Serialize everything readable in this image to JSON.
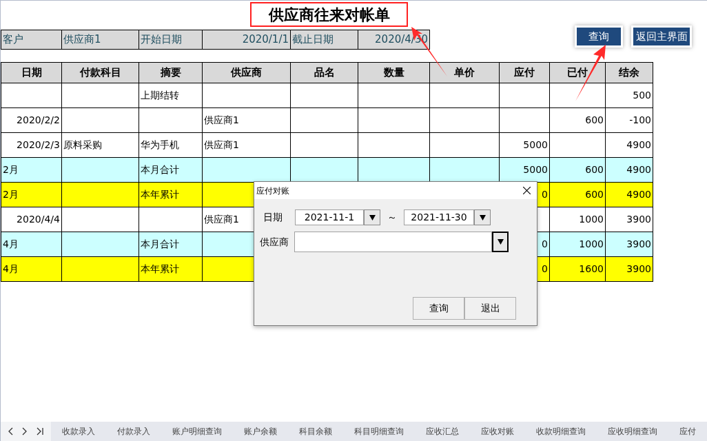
{
  "title": "供应商往来对帐单",
  "info": [
    {
      "text": "客户",
      "kind": "label"
    },
    {
      "text": "供应商1",
      "kind": "label"
    },
    {
      "text": "开始日期",
      "kind": "label"
    },
    {
      "text": "2020/1/1",
      "kind": "value"
    },
    {
      "text": "截止日期",
      "kind": "label"
    },
    {
      "text": "2020/4/30",
      "kind": "value"
    }
  ],
  "buttons": [
    "查询",
    "返回主界面"
  ],
  "table": {
    "columns": [
      "日期",
      "付款科目",
      "摘要",
      "供应商",
      "品名",
      "数量",
      "单价",
      "应付",
      "已付",
      "结余"
    ],
    "rows": [
      {
        "kind": "normal",
        "cells": [
          "",
          "",
          "上期结转",
          "",
          "",
          "",
          "",
          "",
          "",
          "500"
        ]
      },
      {
        "kind": "normal",
        "cells": [
          "2020/2/2",
          "",
          "",
          "供应商1",
          "",
          "",
          "",
          "",
          "600",
          "-100"
        ]
      },
      {
        "kind": "normal",
        "cells": [
          "2020/2/3",
          "原料采购",
          "华为手机",
          "供应商1",
          "",
          "",
          "",
          "5000",
          "",
          "4900"
        ]
      },
      {
        "kind": "month",
        "cells": [
          "2月",
          "",
          "本月合计",
          "",
          "",
          "",
          "",
          "5000",
          "600",
          "4900"
        ]
      },
      {
        "kind": "year",
        "cells": [
          "2月",
          "",
          "本年累计",
          "",
          "",
          "",
          "",
          "0",
          "600",
          "4900"
        ]
      },
      {
        "kind": "normal",
        "cells": [
          "2020/4/4",
          "",
          "",
          "供应商1",
          "",
          "",
          "",
          "",
          "1000",
          "3900"
        ]
      },
      {
        "kind": "month",
        "cells": [
          "4月",
          "",
          "本月合计",
          "",
          "",
          "",
          "",
          "0",
          "1000",
          "3900"
        ]
      },
      {
        "kind": "year",
        "cells": [
          "4月",
          "",
          "本年累计",
          "",
          "",
          "",
          "",
          "0",
          "1600",
          "3900"
        ]
      }
    ]
  },
  "dialog": {
    "title": "应付对账",
    "date_label": "日期",
    "date_from": "2021-11-1",
    "separator": "～",
    "date_to": "2021-11-30",
    "supplier_label": "供应商",
    "buttons": [
      "查询",
      "退出"
    ]
  },
  "sheet_tabs": [
    "收款录入",
    "付款录入",
    "账户明细查询",
    "账户余额",
    "科目余额",
    "科目明细查询",
    "应收汇总",
    "应收对账",
    "收款明细查询",
    "应收明细查询",
    "应付"
  ]
}
